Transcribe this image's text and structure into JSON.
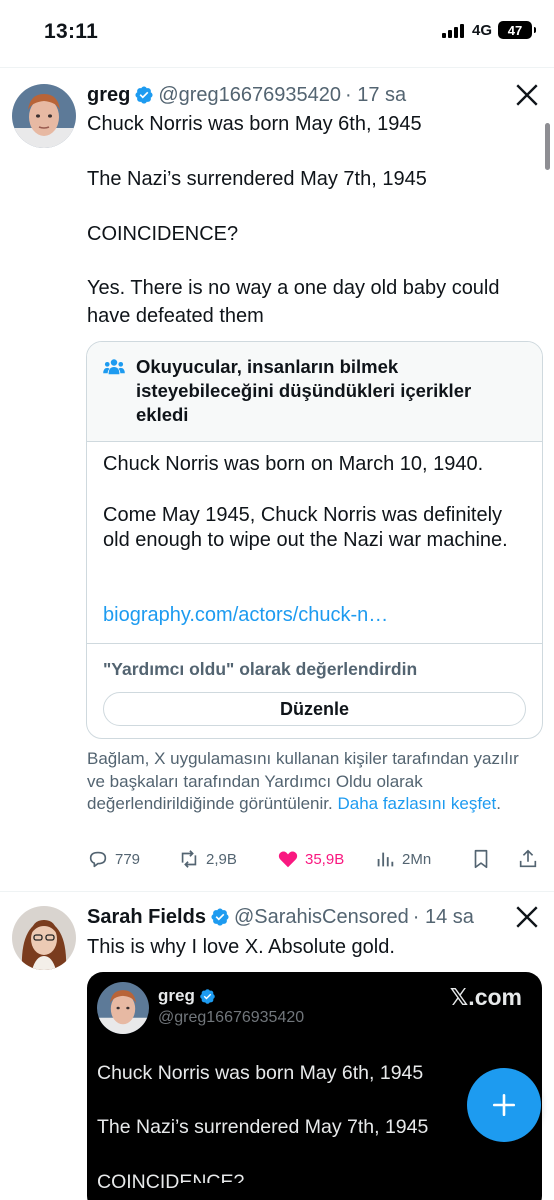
{
  "status_bar": {
    "time": "13:11",
    "network": "4G",
    "battery": "47"
  },
  "tweet1": {
    "name": "greg",
    "handle": "@greg16676935420",
    "time": "· 17 sa",
    "lines": [
      "Chuck Norris was born May 6th, 1945",
      "The Nazi’s surrendered May 7th, 1945",
      "COINCIDENCE?",
      "Yes. There is no way a one day old baby could have defeated them"
    ],
    "note": {
      "title": "Okuyucular, insanların bilmek isteyebileceğini düşündükleri içerikler ekledi",
      "p1": "Chuck Norris was born on March 10, 1940.",
      "p2": "Come May 1945, Chuck Norris was definitely old enough to wipe out the Nazi war machine.",
      "link": "biography.com/actors/chuck-n…",
      "rated": "\"Yardımcı oldu\" olarak değerlendirdin",
      "edit_label": "Düzenle"
    },
    "context_text": "Bağlam, X uygulamasını kullanan kişiler tarafından yazılır ve başkaları tarafından Yardımcı Oldu olarak değerlendirildiğinde görüntülenir.",
    "context_link": "Daha fazlasını keşfet",
    "context_end": ".",
    "stats": {
      "replies": "779",
      "reposts": "2,9B",
      "likes": "35,9B",
      "views": "2Mn"
    },
    "colors": {
      "like": "#f91880",
      "link": "#1d9bf0"
    }
  },
  "tweet2": {
    "name": "Sarah Fields",
    "handle": "@SarahisCensored",
    "time": "· 14 sa",
    "text": "This is why I love X. Absolute gold.",
    "embed": {
      "name": "greg",
      "handle": "@greg16676935420",
      "brand": "𝕏.com",
      "lines": [
        "Chuck Norris was born May 6th, 1945",
        "The Nazi’s surrendered May 7th, 1945",
        "COINCIDENCE?"
      ]
    }
  },
  "fab_icon": "plus-icon"
}
